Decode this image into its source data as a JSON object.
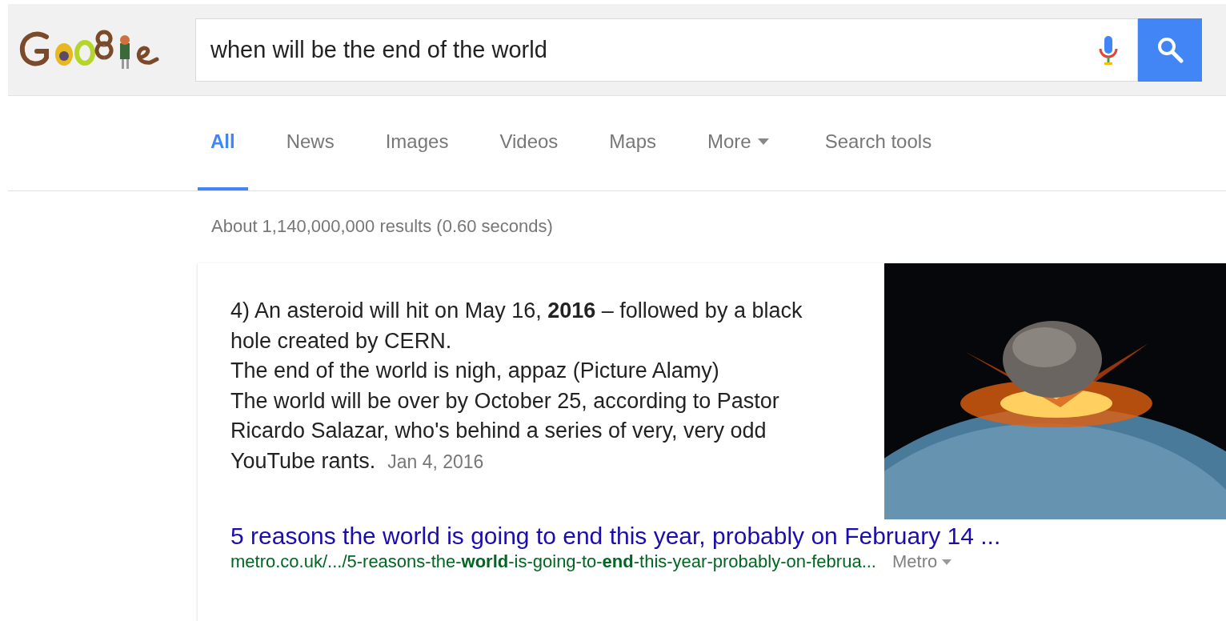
{
  "search": {
    "value": "when will be the end of the world"
  },
  "tabs": [
    {
      "label": "All",
      "selected": true,
      "kind": "tab"
    },
    {
      "label": "News",
      "selected": false,
      "kind": "tab"
    },
    {
      "label": "Images",
      "selected": false,
      "kind": "tab"
    },
    {
      "label": "Videos",
      "selected": false,
      "kind": "tab"
    },
    {
      "label": "Maps",
      "selected": false,
      "kind": "tab"
    },
    {
      "label": "More",
      "selected": false,
      "kind": "dropdown"
    }
  ],
  "tools_button": {
    "label": "Search tools"
  },
  "result_stats": "About 1,140,000,000 results (0.60 seconds)",
  "featured_snippet": {
    "paragraphs": [
      "4) An asteroid will hit on May 16, **2016** – followed by a black hole created by CERN.",
      "The end of the world is nigh, appaz (Picture Alamy)",
      "The world will be over by October 25, according to Pastor Ricardo Salazar, who's behind a series of very, very odd YouTube rants."
    ],
    "date": "Jan 4, 2016",
    "title": "5 reasons the world is going to end this year, probably on February 14 ...",
    "url": "metro.co.uk/.../5-reasons-the-**world**-is-going-to-**end**-this-year-probably-on-februa...",
    "source": "Metro"
  }
}
